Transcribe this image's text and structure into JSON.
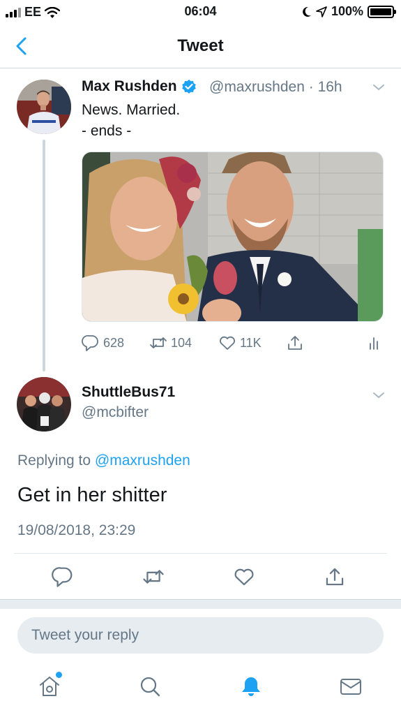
{
  "status_bar": {
    "carrier": "EE",
    "time": "06:04",
    "battery": "100%"
  },
  "nav": {
    "title": "Tweet"
  },
  "original_tweet": {
    "name": "Max Rushden",
    "handle": "@maxrushden",
    "separator": "·",
    "age": "16h",
    "text_line1": "News. Married.",
    "text_line2": "- ends -",
    "replies": "628",
    "retweets": "104",
    "likes": "11K"
  },
  "reply_tweet": {
    "name": "ShuttleBus71",
    "handle": "@mcbifter",
    "replying_prefix": "Replying to",
    "replying_handle": "@maxrushden",
    "text": "Get in her shitter",
    "date": "19/08/2018, 23:29"
  },
  "compose": {
    "placeholder": "Tweet your reply"
  },
  "colors": {
    "accent": "#1da1f2",
    "secondary_text": "#657786",
    "divider": "#e1e8ed"
  },
  "icons": [
    "back-chevron-icon",
    "verified-icon",
    "chevron-down-icon",
    "reply-icon",
    "retweet-icon",
    "like-icon",
    "share-icon",
    "analytics-icon",
    "home-icon",
    "search-icon",
    "notifications-icon",
    "messages-icon"
  ]
}
